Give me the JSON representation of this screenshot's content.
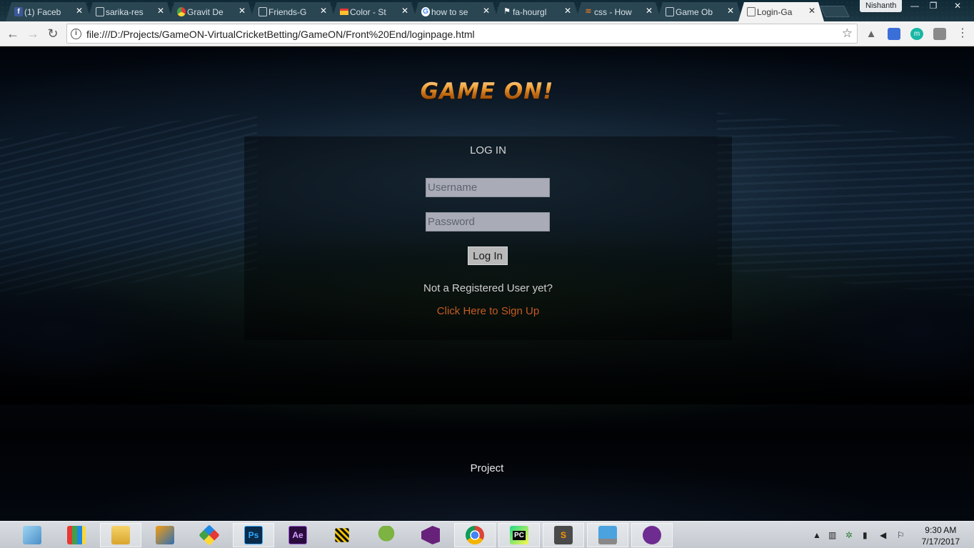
{
  "browser": {
    "tabs": [
      {
        "title": "(1) Faceb",
        "icon": "facebook-icon"
      },
      {
        "title": "sarika-res",
        "icon": "page-icon"
      },
      {
        "title": "Gravit De",
        "icon": "gravit-icon"
      },
      {
        "title": "Friends-G",
        "icon": "page-icon"
      },
      {
        "title": "Color - St",
        "icon": "color-icon"
      },
      {
        "title": "how to se",
        "icon": "google-icon"
      },
      {
        "title": "fa-hourgl",
        "icon": "flag-icon"
      },
      {
        "title": "css - How",
        "icon": "stackoverflow-icon"
      },
      {
        "title": "Game Ob",
        "icon": "page-icon"
      },
      {
        "title": "Login-Ga",
        "icon": "page-icon",
        "active": true
      }
    ],
    "tab_close": "✕",
    "user_name": "Nishanth",
    "window_controls": {
      "minimize": "—",
      "restore": "❐",
      "close": "✕"
    },
    "address": "file:///D:/Projects/GameON-VirtualCricketBetting/GameON/Front%20End/loginpage.html",
    "extensions_label": "m"
  },
  "page": {
    "logo_text": "GAME ON!",
    "login": {
      "title": "LOG IN",
      "username_placeholder": "Username",
      "password_placeholder": "Password",
      "button_label": "Log In",
      "prompt": "Not a Registered User yet?",
      "signup_link": "Click Here to Sign Up"
    },
    "footer": "Project"
  },
  "taskbar": {
    "apps": [
      {
        "name": "virtualbox-icon",
        "label": ""
      },
      {
        "name": "start-apps-icon",
        "label": ""
      },
      {
        "name": "file-explorer-icon",
        "label": ""
      },
      {
        "name": "media-player-icon",
        "label": ""
      },
      {
        "name": "gitkraken-icon",
        "label": ""
      },
      {
        "name": "photoshop-icon",
        "label": "Ps"
      },
      {
        "name": "after-effects-icon",
        "label": "Ae"
      },
      {
        "name": "brackets-icon",
        "label": ""
      },
      {
        "name": "android-studio-icon",
        "label": ""
      },
      {
        "name": "visual-studio-icon",
        "label": ""
      },
      {
        "name": "chrome-icon",
        "label": ""
      },
      {
        "name": "pycharm-icon",
        "label": "PC"
      },
      {
        "name": "sublime-text-icon",
        "label": "S"
      },
      {
        "name": "screen-icon",
        "label": ""
      },
      {
        "name": "github-icon",
        "label": ""
      }
    ],
    "time": "9:30 AM",
    "date": "7/17/2017"
  },
  "colors": {
    "accent_link": "#c55a22",
    "logo_gold": "#f0a038",
    "input_bg": "#a9acb6",
    "button_bg": "#b9b9b9"
  }
}
